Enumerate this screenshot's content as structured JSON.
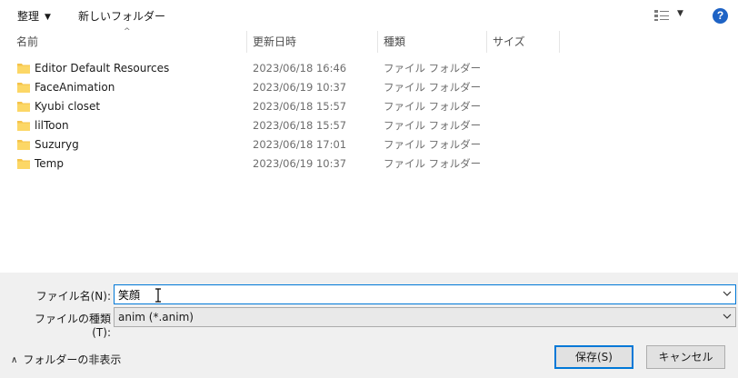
{
  "toolbar": {
    "organize_label": "整理",
    "new_folder_label": "新しいフォルダー",
    "view_icon": "details-view-icon",
    "help_label": "?"
  },
  "columns": {
    "name": "名前",
    "date": "更新日時",
    "type": "種類",
    "size": "サイズ"
  },
  "files": [
    {
      "name": "Editor Default Resources",
      "date": "2023/06/18 16:46",
      "type": "ファイル フォルダー"
    },
    {
      "name": "FaceAnimation",
      "date": "2023/06/19 10:37",
      "type": "ファイル フォルダー"
    },
    {
      "name": "Kyubi closet",
      "date": "2023/06/18 15:57",
      "type": "ファイル フォルダー"
    },
    {
      "name": "lilToon",
      "date": "2023/06/18 15:57",
      "type": "ファイル フォルダー"
    },
    {
      "name": "Suzuryg",
      "date": "2023/06/18 17:01",
      "type": "ファイル フォルダー"
    },
    {
      "name": "Temp",
      "date": "2023/06/19 10:37",
      "type": "ファイル フォルダー"
    }
  ],
  "form": {
    "filename_label": "ファイル名(N):",
    "filename_value": "笑顔",
    "filetype_label": "ファイルの種類(T):",
    "filetype_value": "anim (*.anim)",
    "hide_folders_label": "フォルダーの非表示"
  },
  "buttons": {
    "save": "保存(S)",
    "cancel": "キャンセル"
  },
  "colors": {
    "accent": "#0078d7",
    "folder": "#f5c34a",
    "help": "#1e63c5"
  }
}
